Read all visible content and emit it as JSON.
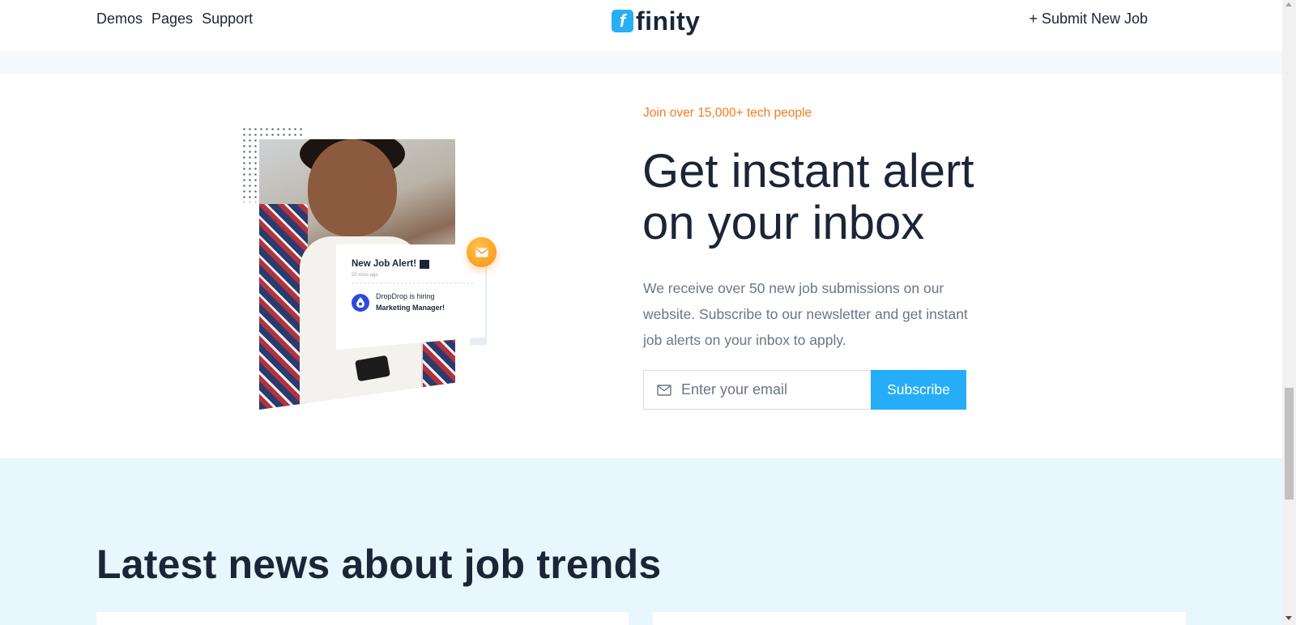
{
  "header": {
    "nav": [
      "Demos",
      "Pages",
      "Support"
    ],
    "logo_mark": "f",
    "logo_text": "finity",
    "submit_job": "+ Submit New Job"
  },
  "hero": {
    "kicker": "Join over 15,000+ tech people",
    "title": "Get instant alert on your inbox",
    "description": "We receive over 50 new job submissions on our website. Subscribe to our newsletter and get instant job alerts on your inbox to apply.",
    "email_placeholder": "Enter your email",
    "subscribe_label": "Subscribe",
    "alert_card": {
      "title": "New Job Alert!",
      "time": "20 mins ago",
      "company_line": "DropDrop is hiring",
      "role": "Marketing Manager!"
    }
  },
  "news": {
    "title": "Latest news about job trends"
  },
  "colors": {
    "accent": "#25adf7",
    "kicker": "#f47a20",
    "dark": "#1b2537",
    "news_bg": "#e8f6fd"
  }
}
